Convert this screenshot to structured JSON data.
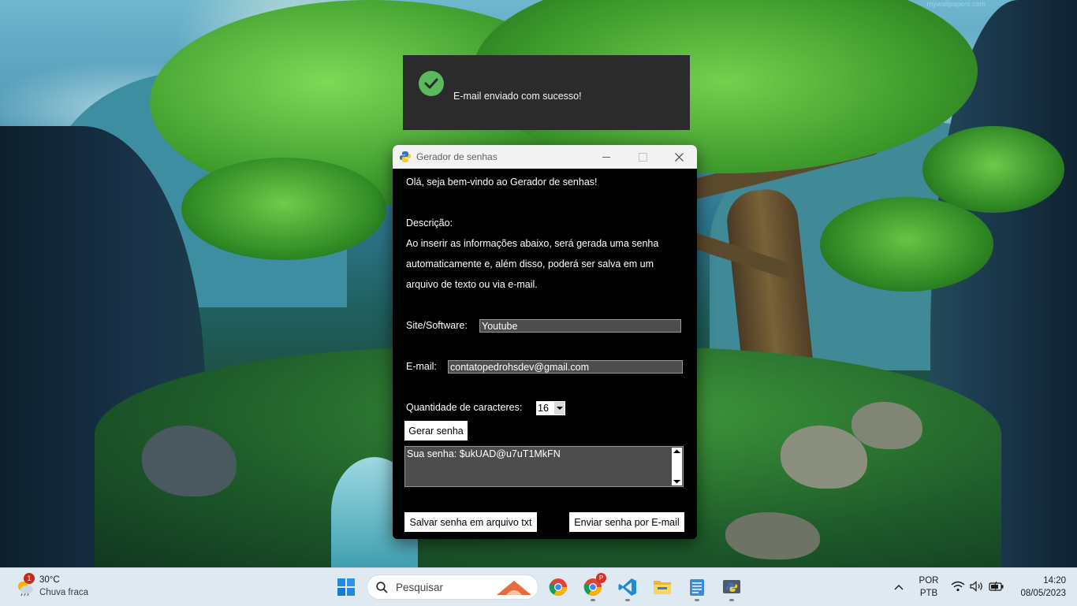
{
  "wallpaper": {
    "watermark": "mywallpapers.com"
  },
  "toast": {
    "icon": "check-circle-icon",
    "message": "E-mail enviado com sucesso!"
  },
  "window": {
    "title": "Gerador de senhas",
    "controls": [
      "minimize",
      "maximize",
      "close"
    ]
  },
  "app": {
    "greeting": "Olá, seja bem-vindo ao Gerador de senhas!",
    "description_label": "Descrição:",
    "description_lines": [
      "Ao inserir as informações abaixo, será gerada uma senha",
      "automaticamente e, além disso, poderá ser salva em um",
      "arquivo de texto ou via e-mail."
    ],
    "site_label": "Site/Software:",
    "site_value": "Youtube",
    "email_label": "E-mail:",
    "email_value": "contatopedrohsdev@gmail.com",
    "qty_label": "Quantidade de caracteres:",
    "qty_value": "16",
    "generate_button": "Gerar senha",
    "result_text": "Sua senha: $ukUAD@u7uT1MkFN",
    "save_txt_button": "Salvar senha em arquivo txt",
    "send_email_button": "Enviar senha por E-mail"
  },
  "taskbar": {
    "weather": {
      "badge": "1",
      "temp": "30°C",
      "condition": "Chuva fraca"
    },
    "search_placeholder": "Pesquisar",
    "pinned": [
      "windows-start-icon",
      "chrome-icon",
      "chrome-profile-icon",
      "vscode-icon",
      "file-explorer-icon",
      "notepad-icon",
      "python-icon"
    ],
    "chrome_profile_badge": "P",
    "tray": {
      "lang_top": "POR",
      "lang_bottom": "PTB",
      "time": "14:20",
      "date": "08/05/2023"
    }
  },
  "colors": {
    "window_bg": "#000000",
    "field_bg": "#4d4d4d",
    "toast_bg": "#2b2b2b",
    "success_green": "#5cb85c",
    "taskbar_bg": "#dfe9f2"
  }
}
